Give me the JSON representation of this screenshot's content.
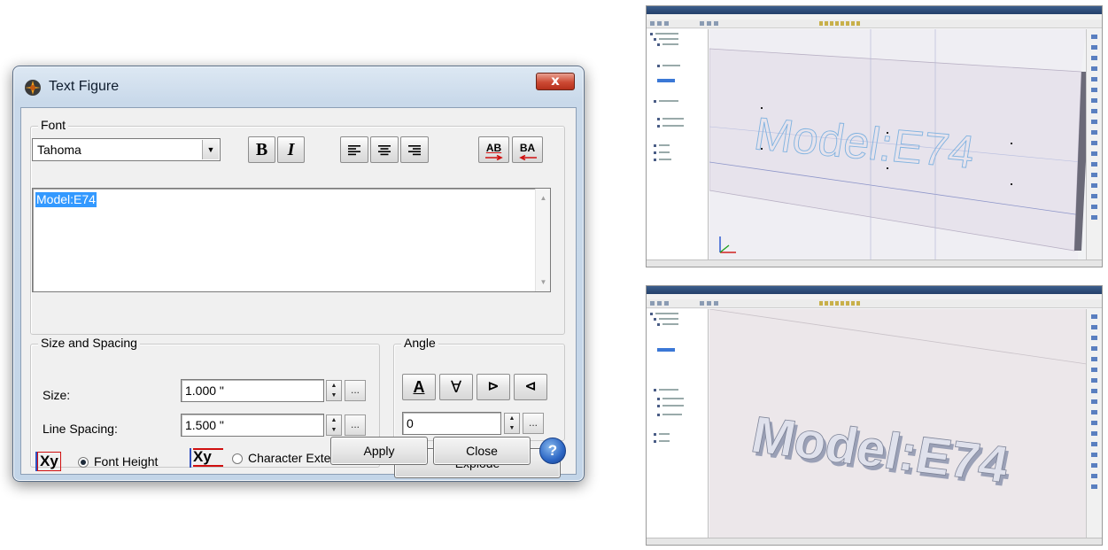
{
  "dialog": {
    "title": "Text Figure",
    "close_glyph": "x",
    "font_group": {
      "legend": "Font",
      "font_name": "Tahoma",
      "bold_label": "B",
      "italic_label": "I",
      "dir_ltr_label": "AB",
      "dir_rtl_label": "BA"
    },
    "text_value": "Model:E74",
    "size_group": {
      "legend": "Size and Spacing",
      "size_label": "Size:",
      "size_value": "1.000 \"",
      "line_spacing_label": "Line Spacing:",
      "line_spacing_value": "1.500 \"",
      "font_height_label": "Font Height",
      "char_extents_label": "Character Extents",
      "xy_glyph": "Xy",
      "selected_mode": "Font Height"
    },
    "angle_group": {
      "legend": "Angle",
      "angle_value": "0",
      "btn_up": "A",
      "btn_down": "∀",
      "btn_right": "⊳",
      "btn_left": "⊲"
    },
    "explode_label": "Explode",
    "apply_label": "Apply",
    "close_label": "Close",
    "help_glyph": "?",
    "spin_glyph": "÷",
    "ellipsis": "..."
  },
  "screens": {
    "top_text": "Model:E74",
    "bottom_text": "Model:E74"
  },
  "colors": {
    "selection": "#3399ff",
    "close_red": "#cd4a34",
    "help_blue": "#2c66c4"
  }
}
